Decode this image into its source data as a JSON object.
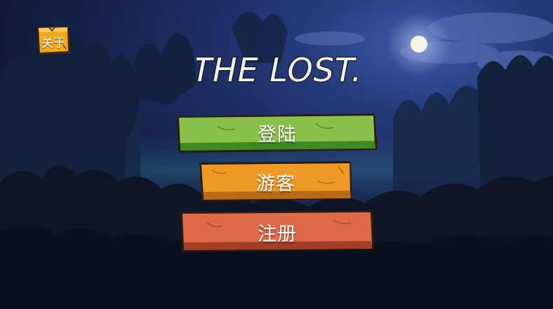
{
  "game": {
    "title": "THE LOST."
  },
  "about_button": {
    "label": "关于",
    "color": "#f0a821"
  },
  "menu": {
    "login": {
      "label": "登陆",
      "color": "#8cc04c"
    },
    "guest": {
      "label": "游客",
      "color": "#ee9a26"
    },
    "register": {
      "label": "注册",
      "color": "#de6a4a"
    }
  },
  "scene": {
    "sky_color": "#1d2f6a",
    "moon_color": "#f4f6e8",
    "forest_color": "#0f1a2a"
  }
}
